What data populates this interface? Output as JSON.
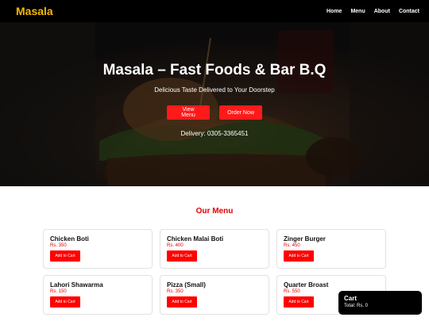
{
  "navbar": {
    "logo": "Masala",
    "links": [
      "Home",
      "Menu",
      "About",
      "Contact"
    ]
  },
  "hero": {
    "title": "Masala – Fast Foods & Bar B.Q",
    "tagline": "Delicious Taste Delivered to Your Doorstep",
    "view_menu_label": "View Menu",
    "order_now_label": "Order Now",
    "delivery": "Delivery: 0305-3365451"
  },
  "menu": {
    "heading": "Our Menu",
    "add_label": "Add to Cart",
    "items": [
      {
        "name": "Chicken Boti",
        "price": "Rs. 350"
      },
      {
        "name": "Chicken Malai Boti",
        "price": "Rs. 400"
      },
      {
        "name": "Zinger Burger",
        "price": "Rs. 450"
      },
      {
        "name": "Lahori Shawarma",
        "price": "Rs. 150"
      },
      {
        "name": "Pizza (Small)",
        "price": "Rs. 350"
      },
      {
        "name": "Quarter Broast",
        "price": "Rs. 550"
      }
    ]
  },
  "cart": {
    "title": "Cart",
    "total": "Total: Rs. 0"
  },
  "colors": {
    "brand": "#f5b800",
    "accent": "#ff1a1a",
    "heading": "#e00000"
  }
}
